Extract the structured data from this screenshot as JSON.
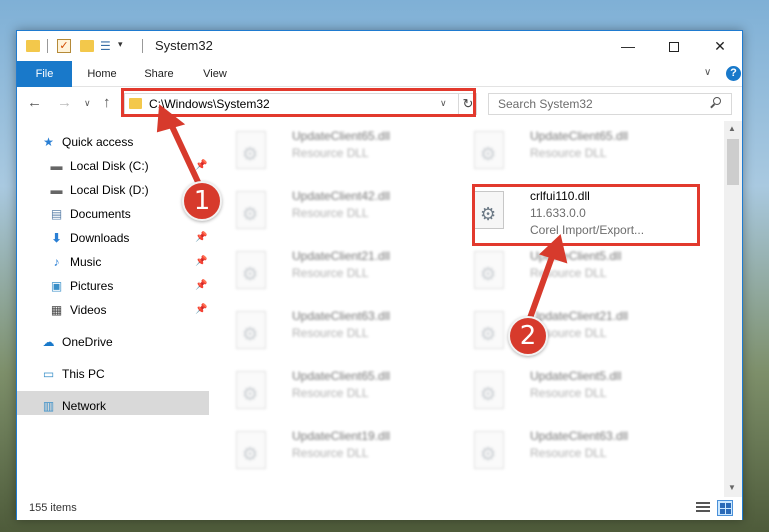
{
  "window": {
    "title": "System32"
  },
  "ribbon": {
    "tabs": [
      "File",
      "Home",
      "Share",
      "View"
    ]
  },
  "address": {
    "path": "C:\\Windows\\System32"
  },
  "search": {
    "placeholder": "Search System32"
  },
  "sidebar": {
    "items": [
      {
        "label": "Quick access",
        "icon": "star-icon"
      },
      {
        "label": "Local Disk (C:)",
        "icon": "drive-icon",
        "pinned": true
      },
      {
        "label": "Local Disk (D:)",
        "icon": "drive-icon"
      },
      {
        "label": "Documents",
        "icon": "documents-icon",
        "pinned": true
      },
      {
        "label": "Downloads",
        "icon": "download-arrow-icon",
        "pinned": true
      },
      {
        "label": "Music",
        "icon": "music-note-icon",
        "pinned": true
      },
      {
        "label": "Pictures",
        "icon": "pictures-icon",
        "pinned": true
      },
      {
        "label": "Videos",
        "icon": "film-icon",
        "pinned": true
      },
      {
        "label": "OneDrive",
        "icon": "cloud-icon"
      },
      {
        "label": "This PC",
        "icon": "monitor-icon",
        "selected": true
      },
      {
        "label": "Network",
        "icon": "network-icon"
      }
    ]
  },
  "files": {
    "left": [
      {
        "name": "UpdateClient65.dll",
        "type": "Resource DLL"
      },
      {
        "name": "UpdateClient42.dll",
        "type": "Resource DLL"
      },
      {
        "name": "UpdateClient21.dll",
        "type": "Resource DLL"
      },
      {
        "name": "UpdateClient63.dll",
        "type": "Resource DLL"
      },
      {
        "name": "UpdateClient65.dll",
        "type": "Resource DLL"
      },
      {
        "name": "UpdateClient19.dll",
        "type": "Resource DLL"
      }
    ],
    "right": [
      {
        "name": "UpdateClient65.dll",
        "type": "Resource DLL"
      },
      {
        "name": "crlfui110.dll",
        "version": "11.633.0.0",
        "type": "Corel Import/Export...",
        "highlighted": true
      },
      {
        "name": "UpdateClient5.dll",
        "type": "Resource DLL"
      },
      {
        "name": "UpdateClient21.dll",
        "type": "Resource DLL"
      },
      {
        "name": "UpdateClient5.dll",
        "type": "Resource DLL"
      },
      {
        "name": "UpdateClient63.dll",
        "type": "Resource DLL"
      }
    ]
  },
  "status": {
    "items": "155 items"
  },
  "annotations": {
    "step1": "1",
    "step2": "2",
    "color": "#e2392d"
  }
}
